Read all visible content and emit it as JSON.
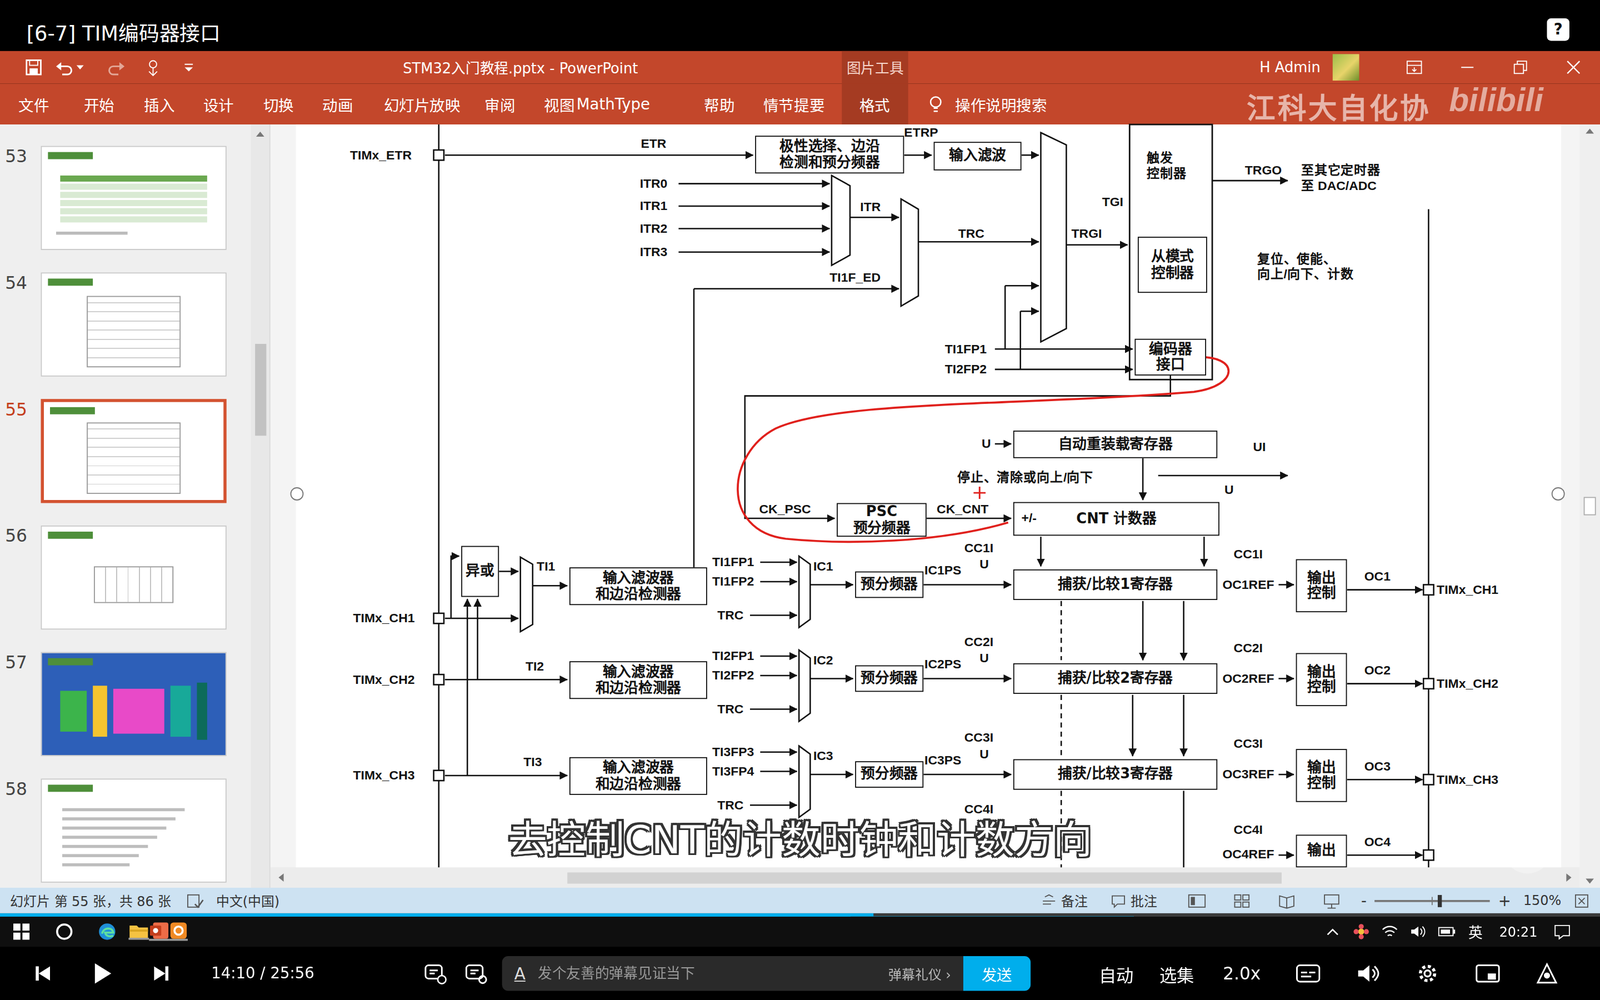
{
  "video": {
    "title": "[6-7] TIM编码器接口",
    "help": "?",
    "subtitle": "去控制CNT的计数时钟和计数方向"
  },
  "window": {
    "title": "STM32入门教程.pptx  -  PowerPoint",
    "context_tab": "图片工具",
    "user": "H Admin"
  },
  "ribbon": {
    "tabs": [
      {
        "label": "文件",
        "selected": false
      },
      {
        "label": "开始",
        "selected": false
      },
      {
        "label": "插入",
        "selected": false
      },
      {
        "label": "设计",
        "selected": false
      },
      {
        "label": "切换",
        "selected": false
      },
      {
        "label": "动画",
        "selected": false
      },
      {
        "label": "幻灯片放映",
        "selected": false
      },
      {
        "label": "审阅",
        "selected": false
      },
      {
        "label": "视图",
        "selected": false
      },
      {
        "label": "MathType",
        "selected": false
      },
      {
        "label": "帮助",
        "selected": false
      },
      {
        "label": "情节提要",
        "selected": false
      },
      {
        "label": "格式",
        "selected": true
      }
    ],
    "search": "操作说明搜索"
  },
  "watermark": {
    "text": "江科大自化协",
    "logo": "bilibili"
  },
  "thumbnails": [
    {
      "number": "53",
      "kind": "table",
      "selected": false
    },
    {
      "number": "54",
      "kind": "diagram",
      "selected": false
    },
    {
      "number": "55",
      "kind": "diagram",
      "selected": true
    },
    {
      "number": "56",
      "kind": "sketch",
      "selected": false
    },
    {
      "number": "57",
      "kind": "colorful",
      "selected": false
    },
    {
      "number": "58",
      "kind": "text",
      "selected": false
    }
  ],
  "diagram": {
    "boxes": [
      {
        "label": "极性选择、边沿\n检测和预分频器"
      },
      {
        "label": "输入滤波"
      },
      {
        "label": "从模式\n控制器"
      },
      {
        "label": "编码器\n接口"
      },
      {
        "label": "自动重装载寄存器"
      },
      {
        "label": "PSC\n预分频器"
      },
      {
        "label": "CNT 计数器"
      },
      {
        "label": "异或"
      },
      {
        "label": "输入滤波器\n和边沿检测器"
      },
      {
        "label": "输入滤波器\n和边沿检测器"
      },
      {
        "label": "输入滤波器\n和边沿检测器"
      },
      {
        "label": "预分频器"
      },
      {
        "label": "预分频器"
      },
      {
        "label": "预分频器"
      },
      {
        "label": "捕获/比较1寄存器"
      },
      {
        "label": "捕获/比较2寄存器"
      },
      {
        "label": "捕获/比较3寄存器"
      },
      {
        "label": "输出\n控制"
      },
      {
        "label": "输出\n控制"
      },
      {
        "label": "输出\n控制"
      },
      {
        "label": "输出"
      }
    ],
    "labels": [
      "TIMx_ETR",
      "ETR",
      "ETRP",
      "ITR0",
      "ITR1",
      "ITR2",
      "ITR3",
      "ITR",
      "TRC",
      "TI1F_ED",
      "TGI",
      "TRGI",
      "触发\n控制器",
      "TRGO",
      "至其它定时器\n至 DAC/ADC",
      "复位、使能、\n向上/向下、计数",
      "TI1FP1",
      "TI2FP2",
      "U",
      "UI",
      "停止、清除或向上/向下",
      "U",
      "CK_PSC",
      "CK_CNT",
      "+/-",
      "TI1",
      "TI1FP1",
      "TI1FP2",
      "TRC",
      "IC1",
      "IC1PS",
      "CC1I",
      "U",
      "CC1I",
      "OC1REF",
      "OC1",
      "TIMx_CH1",
      "TIMx_CH1",
      "TI2",
      "TI2FP1",
      "TI2FP2",
      "TRC",
      "IC2",
      "IC2PS",
      "CC2I",
      "U",
      "CC2I",
      "OC2REF",
      "OC2",
      "TIMx_CH2",
      "TIMx_CH2",
      "TI3",
      "TI3FP3",
      "TI3FP4",
      "TRC",
      "IC3",
      "IC3PS",
      "CC3I",
      "U",
      "CC3I",
      "OC3REF",
      "OC3",
      "TIMx_CH3",
      "TIMx_CH3",
      "CC4I",
      "CC4I",
      "OC4REF",
      "OC4"
    ]
  },
  "status_bar": {
    "slide": "幻灯片 第 55 张，共 86 张",
    "language": "中文(中国)",
    "notes": "备注",
    "comments": "批注",
    "zoom_out": "-",
    "zoom_in": "+",
    "zoom": "150%",
    "zoom_slider": {
      "level": 0.56
    }
  },
  "playback": {
    "progress": {
      "level": 0.546
    },
    "time": "14:10 / 25:56",
    "danmaku": {
      "style_icon": "A",
      "placeholder": "发个友善的弹幕见证当下",
      "etiquette": "弹幕礼仪 ›",
      "send": "发送"
    },
    "auto": "自动",
    "episodes": "选集",
    "speed": "2.0x"
  },
  "taskbar": {
    "ime": "英",
    "clock": "20:21"
  }
}
